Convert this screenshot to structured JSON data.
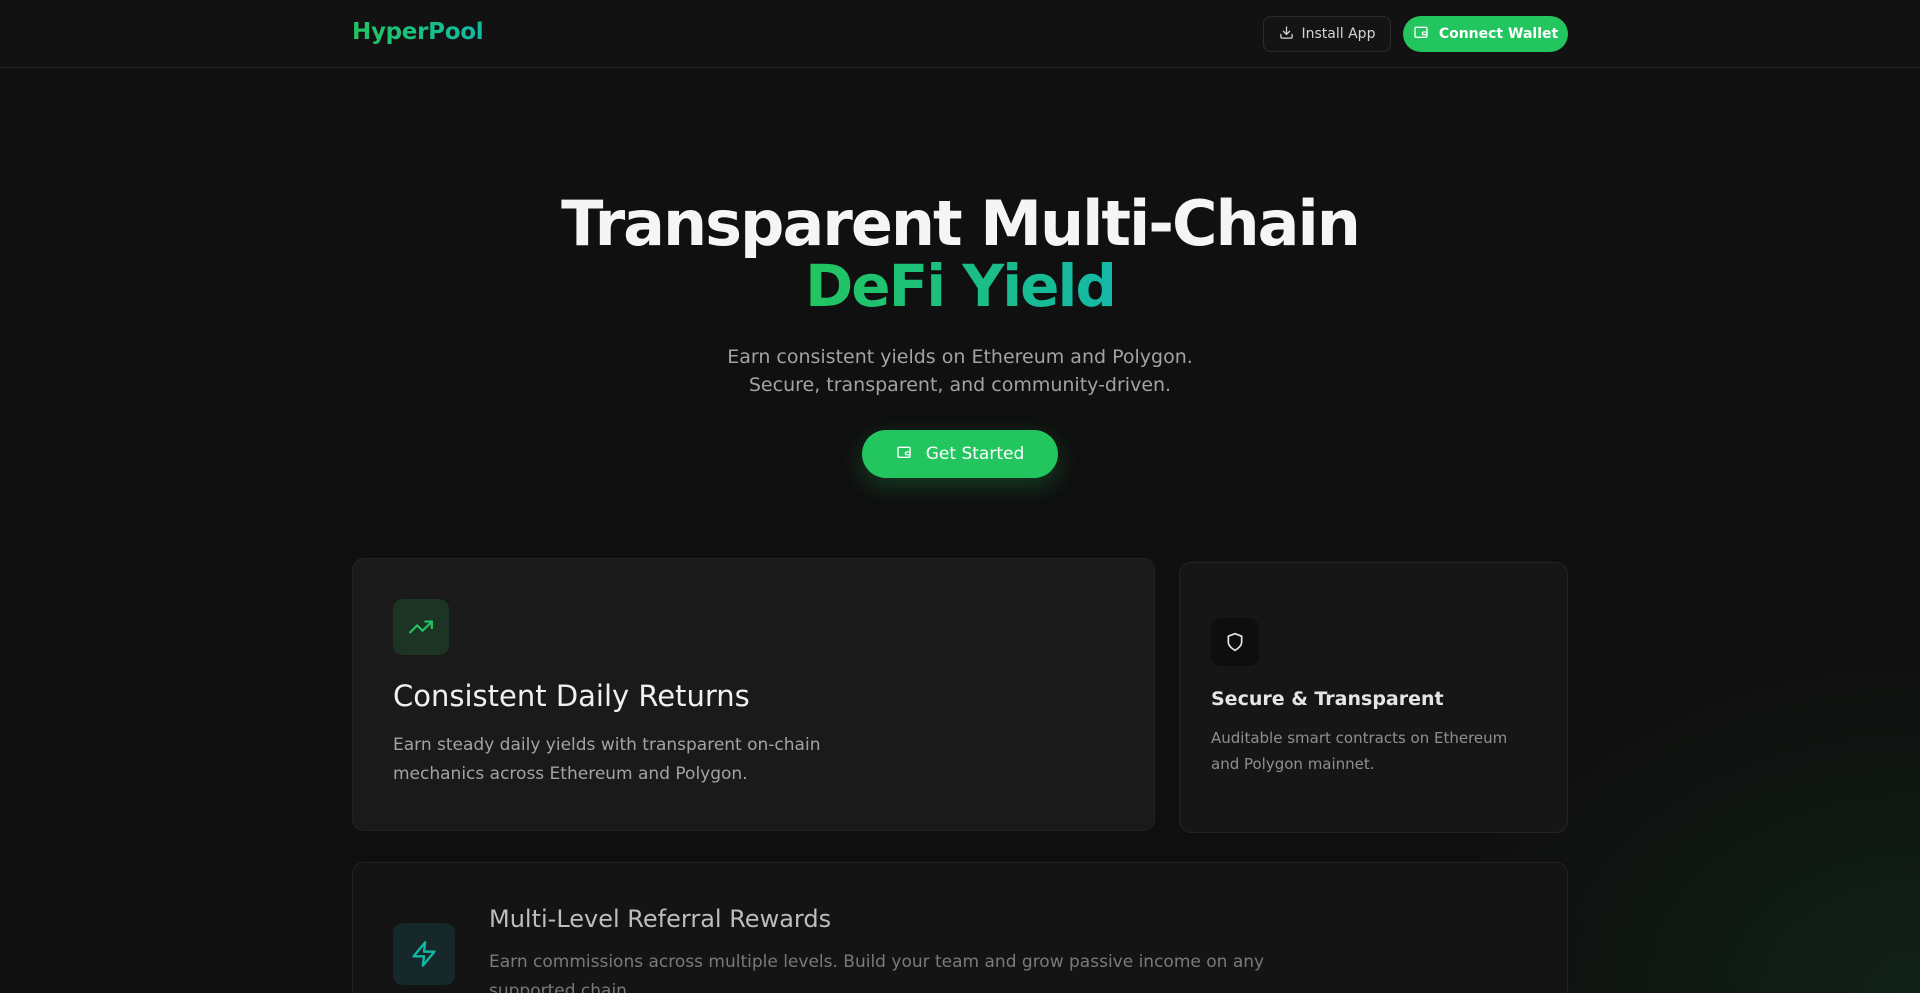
{
  "header": {
    "logo": "HyperPool",
    "install_label": "Install App",
    "connect_label": "Connect Wallet"
  },
  "hero": {
    "title_line1": "Transparent Multi-Chain",
    "title_line2": "DeFi Yield",
    "subtitle_line1": "Earn consistent yields on Ethereum and Polygon.",
    "subtitle_line2": "Secure, transparent, and community-driven.",
    "cta_label": "Get Started"
  },
  "features": [
    {
      "icon": "trending-up-icon",
      "title": "Consistent Daily Returns",
      "description": "Earn steady daily yields with transparent on-chain mechanics across Ethereum and Polygon."
    },
    {
      "icon": "shield-icon",
      "title": "Secure & Transparent",
      "description": "Auditable smart contracts on Ethereum and Polygon mainnet."
    },
    {
      "icon": "lightning-icon",
      "title": "Multi-Level Referral Rewards",
      "description": "Earn commissions across multiple levels. Build your team and grow passive income on any supported chain."
    }
  ],
  "colors": {
    "accent": "#22c55e",
    "accent_secondary": "#14b8a6",
    "background": "#0f0f0f"
  }
}
